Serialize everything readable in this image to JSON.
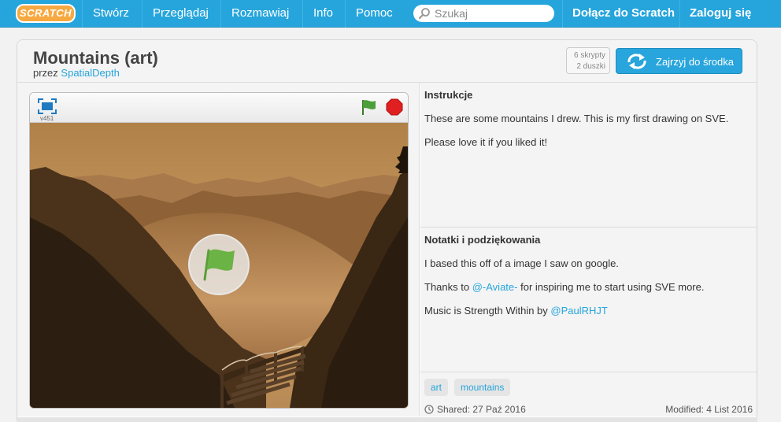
{
  "nav": {
    "logo": "SCRATCH",
    "items": [
      "Stwórz",
      "Przeglądaj",
      "Rozmawiaj",
      "Info",
      "Pomoc"
    ],
    "search_placeholder": "Szukaj",
    "join": "Dołącz do Scratch",
    "signin": "Zaloguj się"
  },
  "project": {
    "title": "Mountains (art)",
    "by_prefix": "przez",
    "author": "SpatialDepth",
    "scripts": "6 skrypty",
    "sprites": "2 duszki",
    "see_inside": "Zajrzyj do środka"
  },
  "player": {
    "version": "v451"
  },
  "instructions": {
    "heading": "Instrukcje",
    "lines": [
      "These are some mountains I drew. This is my first drawing on SVE.",
      "Please love it if you liked it!"
    ]
  },
  "credits": {
    "heading": "Notatki i podziękowania",
    "line1": "I based this off of a image I saw on google.",
    "line2_pre": "Thanks to",
    "line2_link": "@-Aviate-",
    "line2_post": "for inspiring me to start using SVE more.",
    "line3_pre": "Music is Strength Within by",
    "line3_link": "@PaulRHJT"
  },
  "tags": [
    "art",
    "mountains"
  ],
  "shared": "Shared: 27 Paź 2016",
  "modified": "Modified: 4 List 2016",
  "colors": {
    "brand_blue": "#26a5dc",
    "logo_orange": "#f7a941",
    "flag_green": "#4c9e3a",
    "stop_red": "#e02020"
  }
}
